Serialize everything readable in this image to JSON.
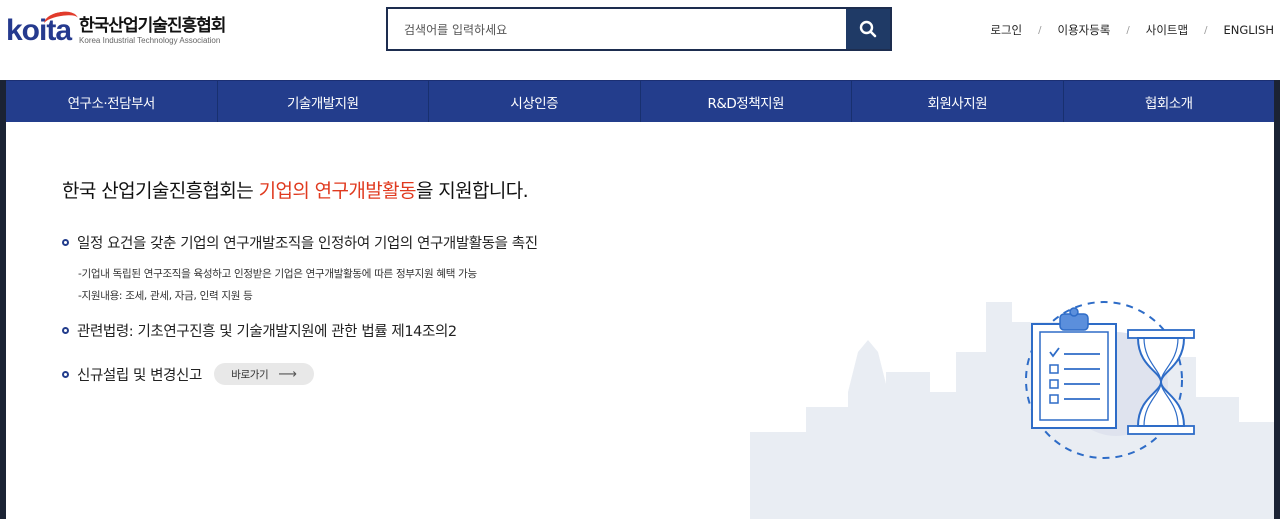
{
  "header": {
    "logo_mark": "koita",
    "logo_kr": "한국산업기술진흥협회",
    "logo_en": "Korea Industrial Technology Association",
    "search_placeholder": "검색어를 입력하세요",
    "util_links": [
      "로그인",
      "이용자등록",
      "사이트맵",
      "ENGLISH"
    ],
    "util_separator": "/"
  },
  "nav": {
    "items": [
      "연구소·전담부서",
      "기술개발지원",
      "시상인증",
      "R&D정책지원",
      "회원사지원",
      "협회소개"
    ]
  },
  "main": {
    "headline_pre": "한국 산업기술진흥협회는 ",
    "headline_highlight": "기업의 연구개발활동",
    "headline_post": "을 지원합니다.",
    "bullet1": "일정 요건을 갖춘 기업의 연구개발조직을 인정하여 기업의 연구개발활동을 촉진",
    "sub1": "-기업내 독립된 연구조직을 육성하고 인정받은 기업은 연구개발활동에 따른 정부지원 혜택 가능",
    "sub2": "-지원내용: 조세, 관세, 자금, 인력 지원 등",
    "bullet2": "관련법령: 기초연구진흥 및 기술개발지원에 관한 법률 제14조의2",
    "bullet3": "신규설립 및 변경신고",
    "goto_label": "바로가기",
    "goto_arrow": "⟶"
  },
  "colors": {
    "brand_navy": "#233d8c",
    "accent_red": "#e03a1f",
    "search_button": "#1f3a66",
    "illustration_blue": "#2e6cc7"
  },
  "icons": {
    "search": "search-icon",
    "checklist": "checklist-clipboard-icon",
    "hourglass": "hourglass-icon"
  }
}
